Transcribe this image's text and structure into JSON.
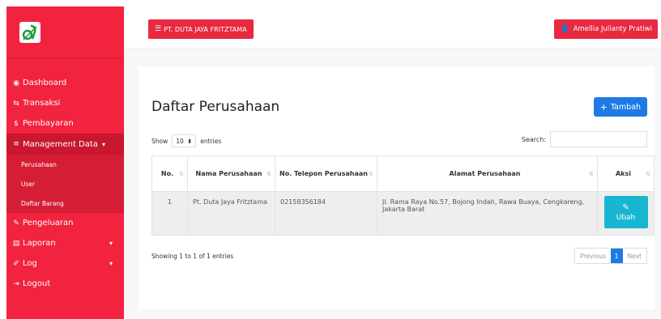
{
  "sidebar": {
    "items": [
      {
        "icon": "dashboard-icon",
        "glyph": "◉",
        "label": "Dashboard"
      },
      {
        "icon": "transaction-icon",
        "glyph": "⇆",
        "label": "Transaksi"
      },
      {
        "icon": "dollar-icon",
        "glyph": "$",
        "label": "Pembayaran"
      },
      {
        "icon": "list-icon",
        "glyph": "≡",
        "label": "Management Data"
      },
      {
        "icon": "edit-icon",
        "glyph": "✎",
        "label": "Pengeluaran"
      },
      {
        "icon": "report-icon",
        "glyph": "▤",
        "label": "Laporan"
      },
      {
        "icon": "log-icon",
        "glyph": "✐",
        "label": "Log"
      },
      {
        "icon": "logout-icon",
        "glyph": "⇥",
        "label": "Logout"
      }
    ],
    "submenu": [
      "Perusahaan",
      "User",
      "Daftar Barang"
    ]
  },
  "topbar": {
    "company": "PT. DUTA JAYA FRITZTAMA",
    "user": "Amellia Julianty Pratiwi"
  },
  "page": {
    "title": "Daftar Perusahaan",
    "add_label": "Tambah",
    "show_label": "Show",
    "entries_value": "10",
    "entries_label": "entries",
    "search_label": "Search:"
  },
  "table": {
    "headers": [
      "No.",
      "Nama Perusahaan",
      "No. Telepon Perusahaan",
      "Alamat Perusahaan",
      "Aksi"
    ],
    "rows": [
      {
        "no": "1",
        "name": "Pt. Duta Jaya Fritztama",
        "phone": "02158356184",
        "address": "Jl. Rama Raya No.57, Bojong Indah, Rawa Buaya, Cengkareng, Jakarta Barat",
        "action": "Ubah"
      }
    ]
  },
  "footer": {
    "info": "Showing 1 to 1 of 1 entries",
    "prev": "Previous",
    "page": "1",
    "next": "Next"
  },
  "colors": {
    "sidebar": "#f2233f",
    "primary": "#1f7ae6",
    "info": "#19b6d2"
  }
}
